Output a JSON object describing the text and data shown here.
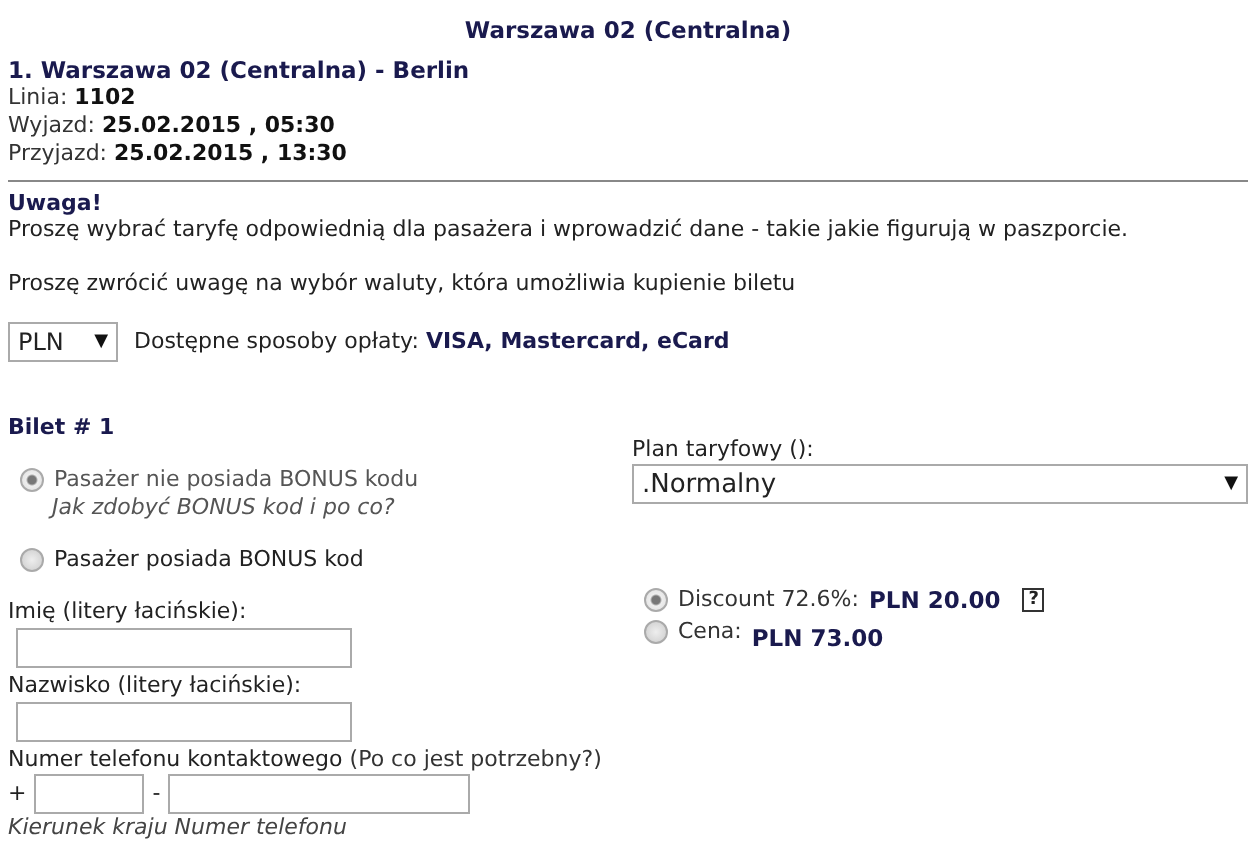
{
  "header": {
    "title": "Warszawa 02 (Centralna)"
  },
  "trip": {
    "route": "1. Warszawa 02 (Centralna) - Berlin",
    "lines": [
      "Linia: **1102**",
      "Wyjazd: **25.02.2015 , 05:30**",
      "Przyjazd: **25.02.2015 , 13:30**"
    ]
  },
  "notice": {
    "title": "Uwaga!",
    "text": "Proszę wybrać taryfę odpowiednią dla pasażera i wprowadzić dane - takie jakie figurują w paszporcie.",
    "currency_note": "Proszę zwrócić uwagę na wybór waluty, która umożliwia kupienie biletu"
  },
  "currency": {
    "value": "PLN",
    "arrow": "▼",
    "payment": "Dostępne sposoby opłaty: **VISA, Mastercard, eCard**"
  },
  "ticket": {
    "title": "Bilet # 1",
    "bonus_options": [
      {
        "label": "Pasażer nie posiada BONUS kodu",
        "hint": "Jak zdobyć BONUS kod i po co?",
        "selected": true
      },
      {
        "label": "Pasażer posiada BONUS kod",
        "selected": false
      }
    ],
    "fields": [
      {
        "label": "Imię (litery łacińskie):"
      },
      {
        "label": "Nazwisko (litery łacińskie):"
      }
    ],
    "phone": {
      "label": "Numer telefonu kontaktowego",
      "link": "(Po co jest potrzebny?)",
      "plus": "+",
      "dash": "-",
      "hint": "Kierunek kraju Numer telefonu"
    },
    "tariff": {
      "label": "Plan taryfowy ():",
      "value": ".Normalny",
      "arrow": "▼"
    },
    "prices": [
      {
        "label": "Discount 72.6%:",
        "amount": "PLN 20.00",
        "help": "?",
        "selected": true
      },
      {
        "label": "Cena:",
        "amount": "PLN 73.00",
        "selected": false
      }
    ]
  }
}
